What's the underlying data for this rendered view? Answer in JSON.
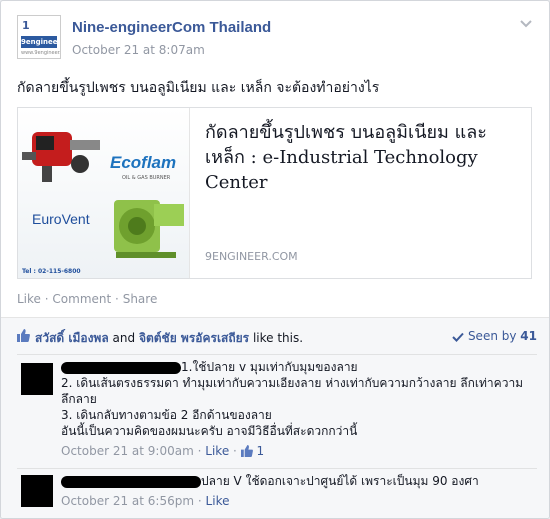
{
  "post": {
    "page_name": "Nine-engineerCom Thailand",
    "timestamp": "October 21 at 8:07am",
    "text": "กัดลายขึ้นรูปเพชร บนอลูมิเนียม และ เหล็ก จะต้องทำอย่างไร",
    "logo": {
      "top": "1",
      "mark": "9engineer",
      "sub": "www.9engineer.com"
    }
  },
  "link_preview": {
    "title": "กัดลายขึ้นรูปเพชร บนอลูมิเนียม และ เหล็ก : e-Industrial Technology Center",
    "domain": "9ENGINEER.COM",
    "image": {
      "brand1": "Ecoflam",
      "brand1_sub": "OIL & GAS BURNER",
      "brand2": "EuroVent",
      "phone": "Tel : 02-115-6800"
    }
  },
  "actions": {
    "like": "Like",
    "comment": "Comment",
    "share": "Share",
    "separator": "·"
  },
  "likes": {
    "name1": "สวัสดิ์ เมืองพล",
    "conjunction": "and",
    "name2": "จิตต์ชัย พรอัครเสถียร",
    "suffix": "like this.",
    "seen_label": "Seen by",
    "seen_count": "41"
  },
  "comments": [
    {
      "line1": "1.ใช้ปลาย v มุมเท่ากับมุมของลาย",
      "line2": "2. เดินเส้นตรงธรรมดา ทำมุมเท่ากับความเอียงลาย ห่างเท่ากับความกว้างลาย ลึกเท่าความลึกลาย",
      "line3": "3. เดินกลับทางตามข้อ 2 อีกด้านของลาย",
      "line4": "อันนี้เป็นความคิดของผมนะครับ อาจมีวิธีอื่นที่สะดวกกว่านี้",
      "time": "October 21 at 9:00am",
      "like": "Like",
      "like_count": "1"
    },
    {
      "line1": "ปลาย V ใช้ดอกเจาะปาศูนย์ได้ เพราะเป็นมุม 90 องศา",
      "time": "October 21 at 6:56pm",
      "like": "Like"
    }
  ],
  "colors": {
    "link": "#3b5998",
    "meta": "#9197a3",
    "ufi_bg": "#f6f7f9"
  }
}
